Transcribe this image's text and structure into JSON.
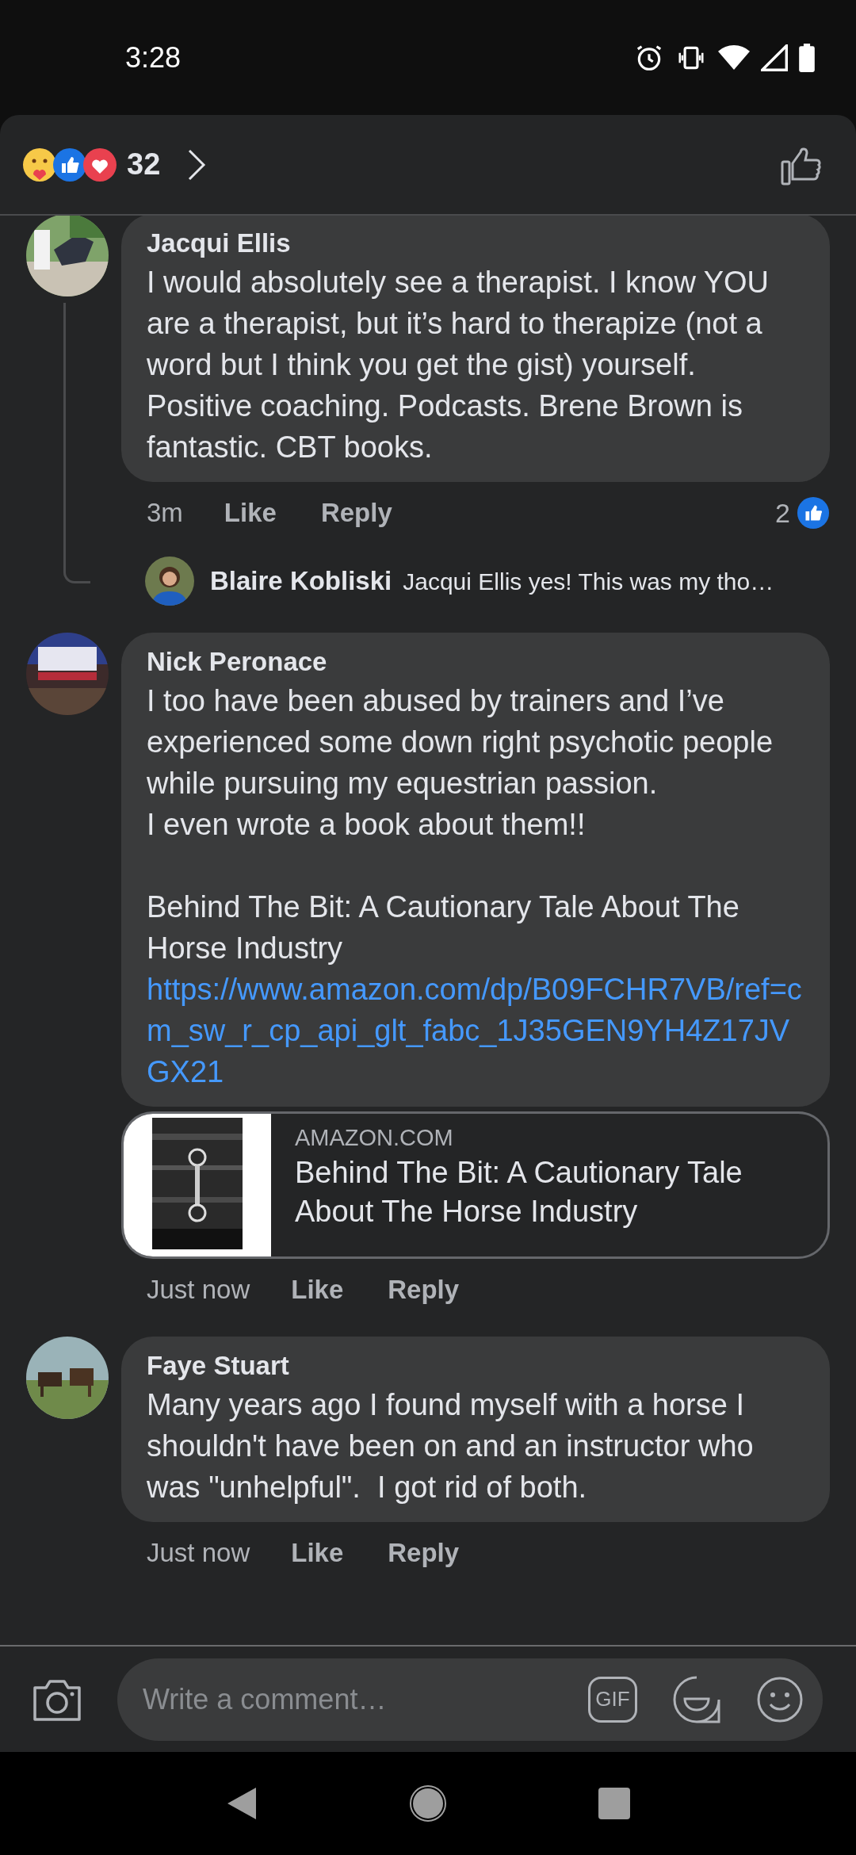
{
  "status_bar": {
    "time": "3:28"
  },
  "reactions_header": {
    "count": "32"
  },
  "comments": [
    {
      "author": "Jacqui Ellis",
      "avatar": {
        "kind": "picture"
      },
      "text": "I would absolutely see a therapist. I know YOU are a therapist, but it’s hard to therapize (not a word but I think you get the gist) yourself.\nPositive coaching. Podcasts. Brene Brown is fantastic. CBT books.",
      "time": "3m",
      "actions": [
        "Like",
        "Reply"
      ],
      "like_count": "2",
      "replies": [
        {
          "author": "Blaire Kobliski",
          "text": "Jacqui Ellis yes! This was my tho…"
        }
      ]
    },
    {
      "author": "Nick Peronace",
      "avatar": {
        "kind": "picture"
      },
      "text": "I too have been abused by trainers and I’ve experienced some down right psychotic people while pursuing my equestrian passion.\nI even wrote a book about them!!\n\nBehind The Bit: A Cautionary Tale About The Horse Industry",
      "link": "https://www.amazon.com/dp/B09FCHR7VB/ref=cm_sw_r_cp_api_glt_fabc_1J35GEN9YH4Z17JVGX21",
      "link_preview": {
        "domain": "AMAZON.COM",
        "title": "Behind The Bit: A Cautionary Tale About The Horse Industry"
      },
      "time": "Just now",
      "actions": [
        "Like",
        "Reply"
      ]
    },
    {
      "author": "Faye Stuart",
      "avatar": {
        "kind": "picture"
      },
      "text": "Many years ago I found myself with a horse I shouldn't have been on and an instructor who was \"unhelpful\".  I got rid of both.",
      "time": "Just now",
      "actions": [
        "Like",
        "Reply"
      ]
    }
  ],
  "composer": {
    "placeholder": "Write a comment…",
    "gif_label": "GIF"
  }
}
